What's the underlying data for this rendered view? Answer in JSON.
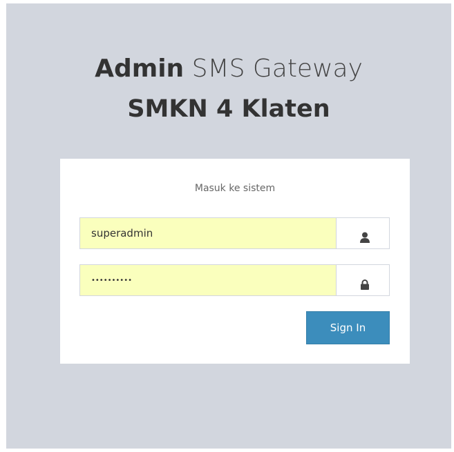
{
  "logo": {
    "bold": "Admin",
    "light": "SMS Gateway",
    "line2": "SMKN 4 Klaten"
  },
  "login": {
    "message": "Masuk ke sistem",
    "username_value": "superadmin",
    "password_value": "••••••••••",
    "signin_label": "Sign In",
    "icons": {
      "username": "user-icon",
      "password": "lock-icon"
    }
  },
  "colors": {
    "background": "#d2d6de",
    "box": "#ffffff",
    "autofill": "#faffbd",
    "button": "#3c8dbc"
  }
}
